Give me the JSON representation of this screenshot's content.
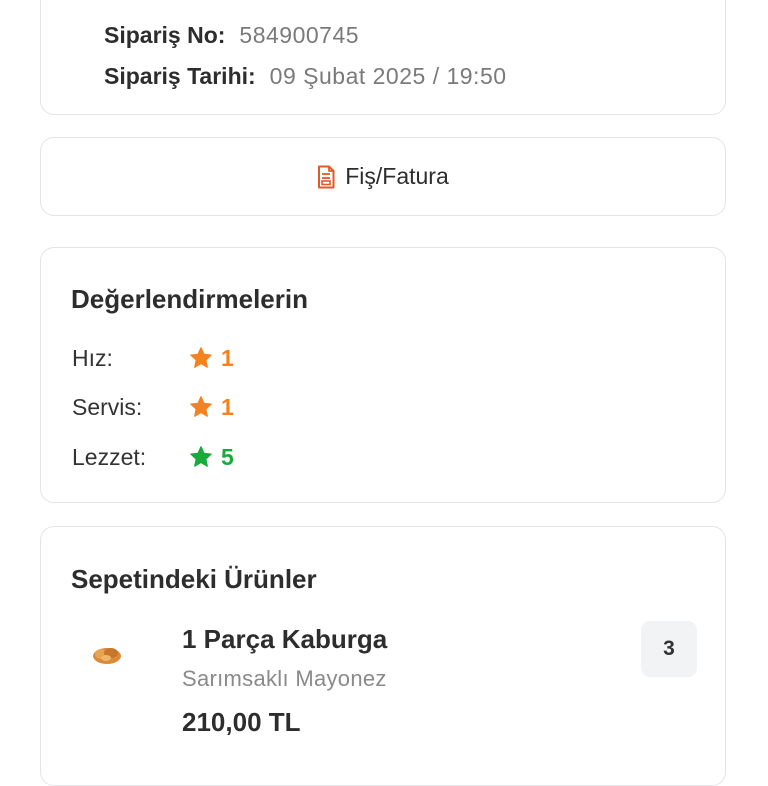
{
  "order": {
    "number_label": "Sipariş No:",
    "number_value": "584900745",
    "date_label": "Sipariş Tarihi:",
    "date_value": "09 Şubat 2025 / 19:50"
  },
  "receipt": {
    "label": "Fiş/Fatura",
    "icon": "document-icon",
    "icon_color": "#e05a2b"
  },
  "ratings": {
    "title": "Değerlendirmelerin",
    "items": [
      {
        "label": "Hız:",
        "value": "1",
        "color": "#f5821f",
        "icon": "star-icon"
      },
      {
        "label": "Servis:",
        "value": "1",
        "color": "#f5821f",
        "icon": "star-icon"
      },
      {
        "label": "Lezzet:",
        "value": "5",
        "color": "#1aaa3c",
        "icon": "star-icon"
      }
    ]
  },
  "basket": {
    "title": "Sepetindeki Ürünler",
    "items": [
      {
        "name": "1 Parça Kaburga",
        "option": "Sarımsaklı Mayonez",
        "price": "210,00 TL",
        "quantity": "3",
        "icon": "food-icon"
      }
    ]
  }
}
